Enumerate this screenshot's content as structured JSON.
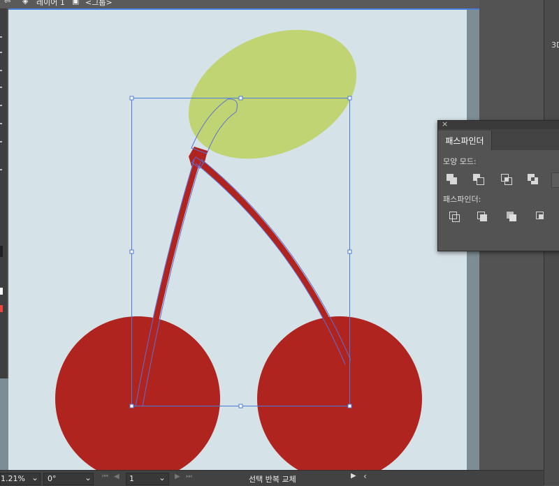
{
  "topbar": {
    "layer_label": "레이어 1",
    "group_label": "<그룹>"
  },
  "right_panel": {
    "label_3d": "3D"
  },
  "pathfinder": {
    "close_label": "×",
    "tab_label": "패스파인더",
    "shape_modes_label": "모양 모드:",
    "pathfinders_label": "패스파인더:",
    "shape_mode_buttons": [
      "unite",
      "minus-front",
      "intersect",
      "exclude"
    ],
    "pathfinder_buttons": [
      "divide",
      "trim",
      "merge",
      "crop"
    ]
  },
  "status": {
    "zoom": "1.21%",
    "rotation": "0°",
    "artboard": "1",
    "selection_text": "선택 반복 교체"
  },
  "colors": {
    "canvas_bg": "#d5e2e7",
    "cherry": "#b0241f",
    "leaf": "#c0d474",
    "selection": "#4a7bd8"
  }
}
